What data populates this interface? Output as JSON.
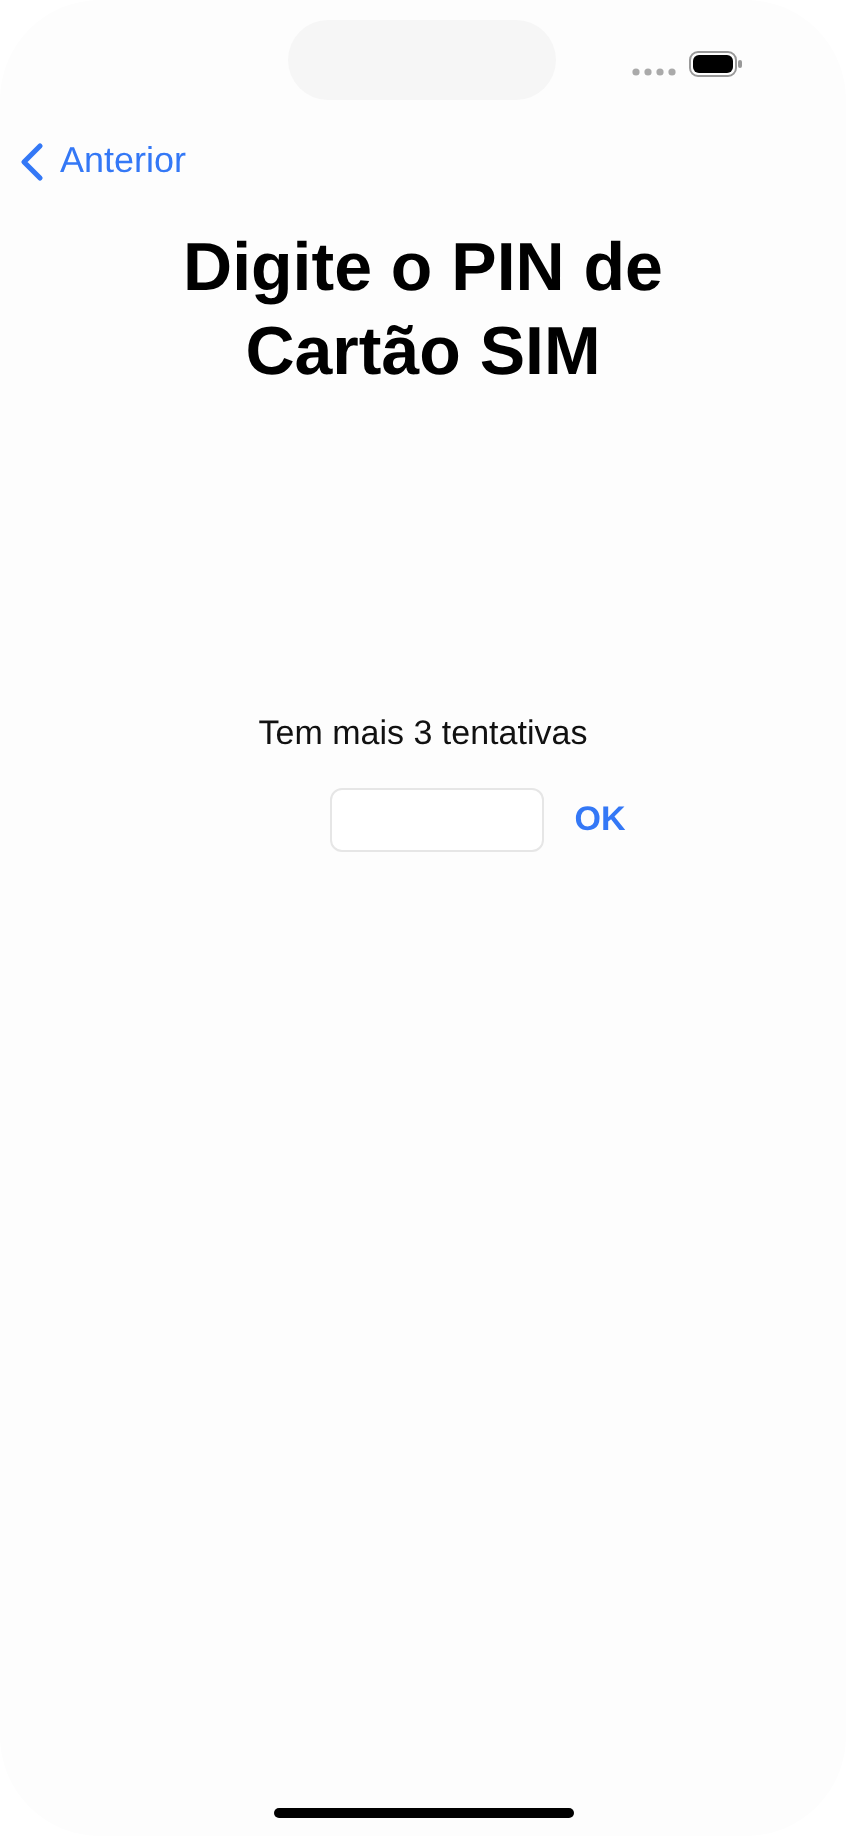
{
  "nav": {
    "back_label": "Anterior"
  },
  "title": "Digite o PIN de Cartão SIM",
  "attempts": "Tem mais 3 tentativas",
  "submit": {
    "label": "OK"
  }
}
